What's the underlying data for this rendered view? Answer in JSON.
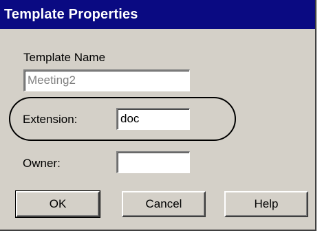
{
  "dialog": {
    "title": "Template Properties"
  },
  "fields": {
    "template_name_label": "Template Name",
    "template_name_value": "Meeting2",
    "extension_label": "Extension:",
    "extension_value": "doc",
    "owner_label": "Owner:",
    "owner_value": ""
  },
  "buttons": {
    "ok": "OK",
    "cancel": "Cancel",
    "help": "Help"
  }
}
